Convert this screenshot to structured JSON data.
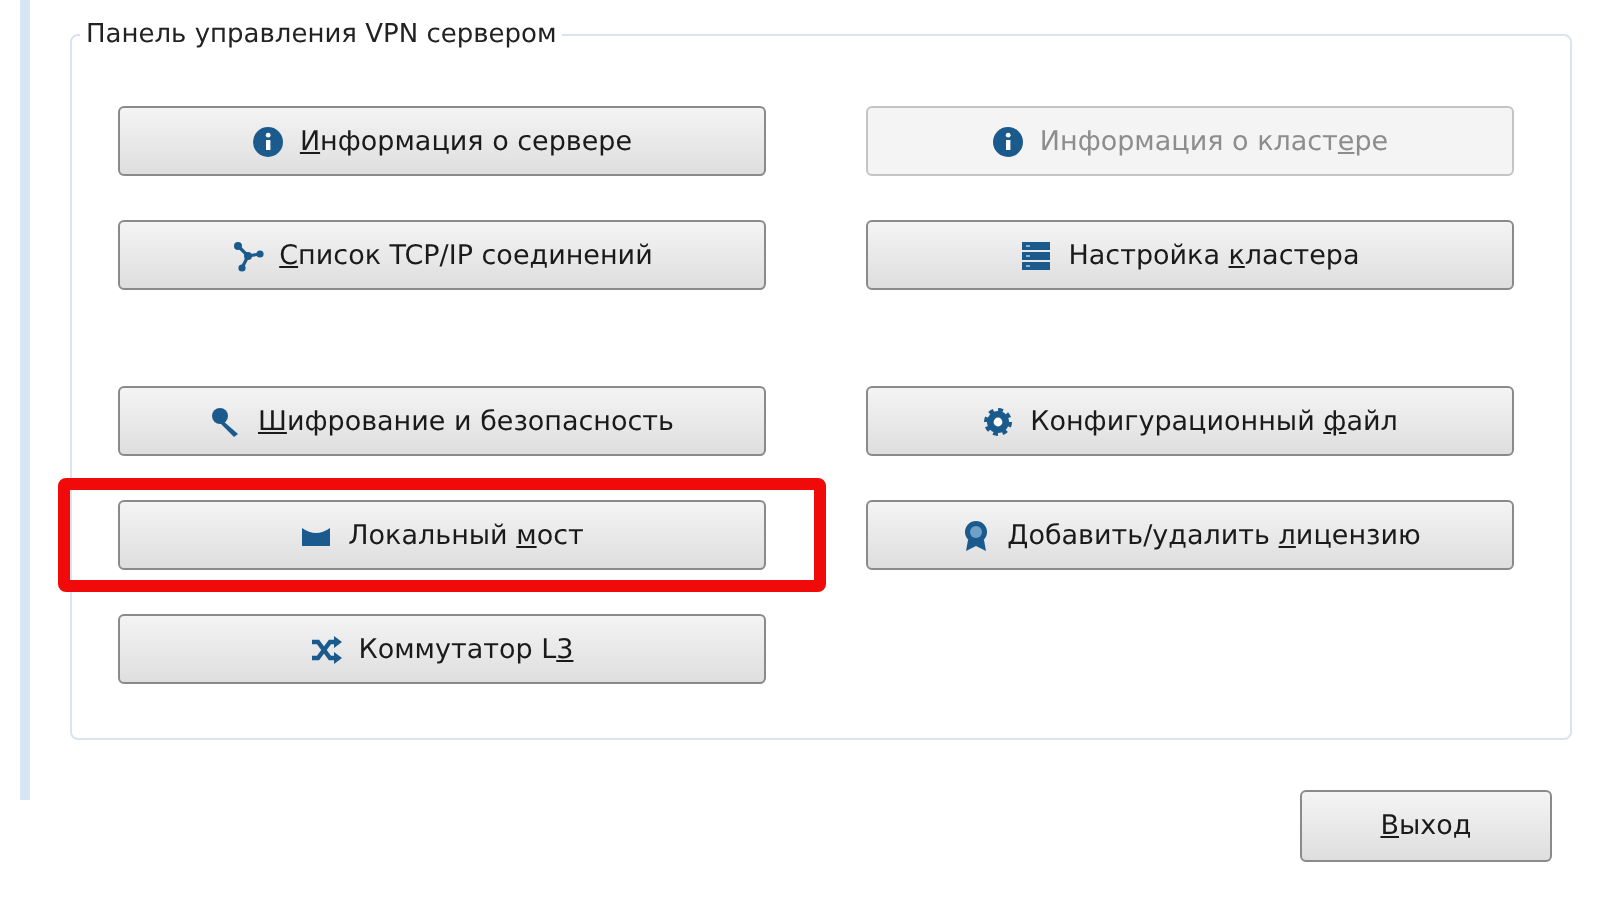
{
  "group": {
    "title": "Панель управления VPN сервером"
  },
  "left_buttons": [
    {
      "key": "И",
      "after": "нформация о сервере",
      "disabled": false,
      "highlighted": false
    },
    {
      "key": "С",
      "after": "писок TCP/IP соединений",
      "disabled": false,
      "highlighted": false
    },
    {
      "key": "Ш",
      "after": "ифрование и безопасность",
      "disabled": false,
      "highlighted": false
    },
    {
      "before": "Локальный ",
      "key": "м",
      "after": "ост",
      "disabled": false,
      "highlighted": true
    },
    {
      "before": "Коммутатор L",
      "key": "3",
      "disabled": false,
      "highlighted": false
    }
  ],
  "right_buttons": [
    {
      "before": "Информация о класт",
      "key": "е",
      "after": "ре",
      "disabled": true,
      "highlighted": false
    },
    {
      "before": "Настройка ",
      "key": "к",
      "after": "ластера",
      "disabled": false,
      "highlighted": false
    },
    {
      "before": "Конфигурационный ",
      "key": "ф",
      "after": "айл",
      "disabled": false,
      "highlighted": false
    },
    {
      "before": "Добавить/удалить ",
      "key": "л",
      "after": "ицензию",
      "disabled": false,
      "highlighted": false
    }
  ],
  "exit_button": {
    "key": "В",
    "after": "ыход"
  }
}
